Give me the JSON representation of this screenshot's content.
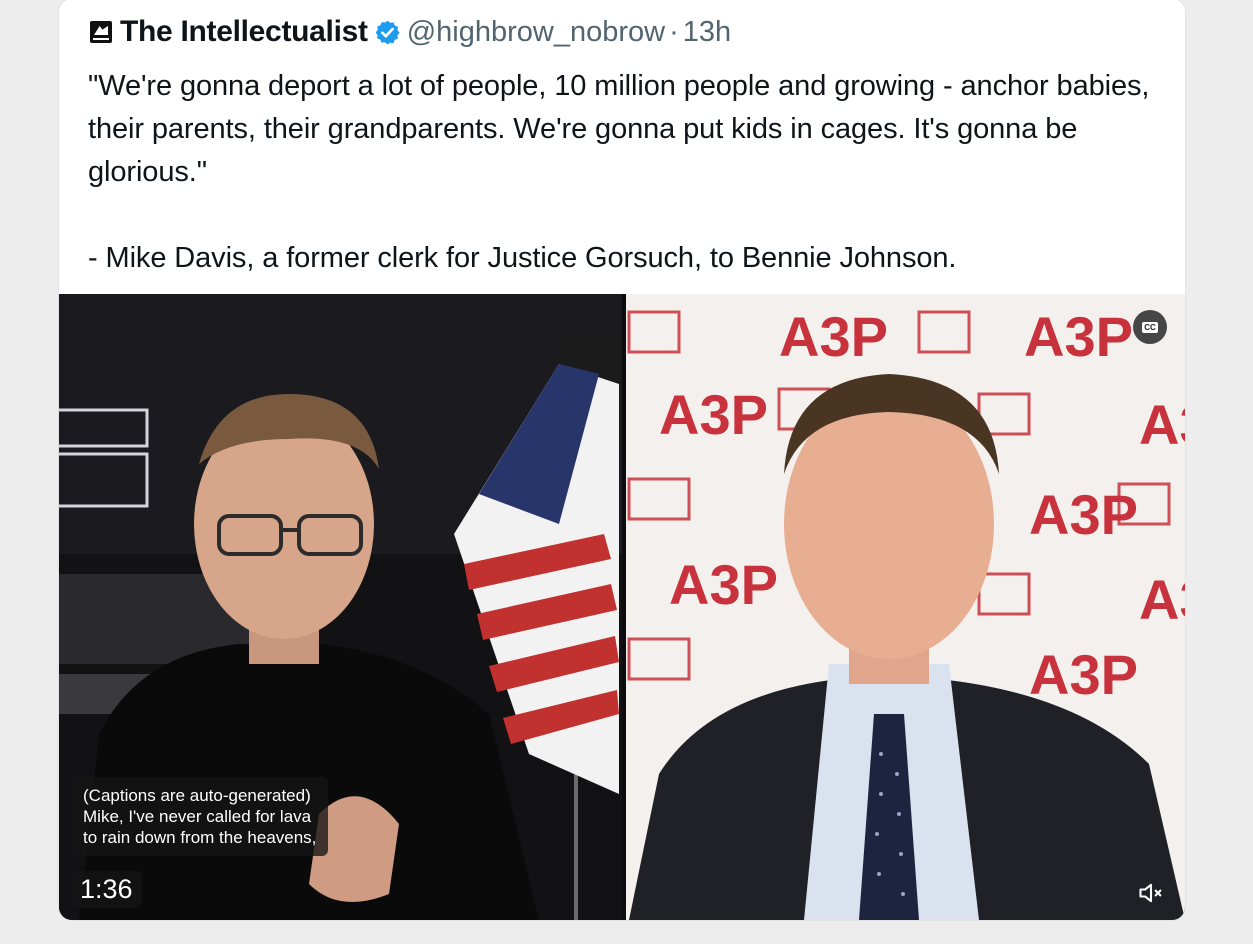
{
  "tweet": {
    "author_name": "The Intellectualist",
    "handle": "@highbrow_nobrow",
    "separator": "·",
    "time": "13h",
    "text_lines": {
      "quote": "\"We're gonna deport a lot of people, 10 million people and growing - anchor babies, their parents, their grandparents. We're gonna put kids in cages. It's gonna be glorious.\"",
      "attribution": "- Mike Davis, a former clerk for Justice Gorsuch, to Bennie Johnson."
    },
    "verified_icon": "verified-badge-icon",
    "avatar_icon": "avatar-logo-icon"
  },
  "video": {
    "captions": {
      "line1": "(Captions are auto-generated)",
      "line2": "Mike, I've never called for lava",
      "line3": "to rain down from the heavens,"
    },
    "duration": "1:36",
    "cc_label": "CC",
    "mute_icon": "muted-speaker-icon",
    "backdrop_logo_text": "A3P",
    "accent_blue": "#1d9bf0",
    "backdrop_red": "#c8323c"
  }
}
